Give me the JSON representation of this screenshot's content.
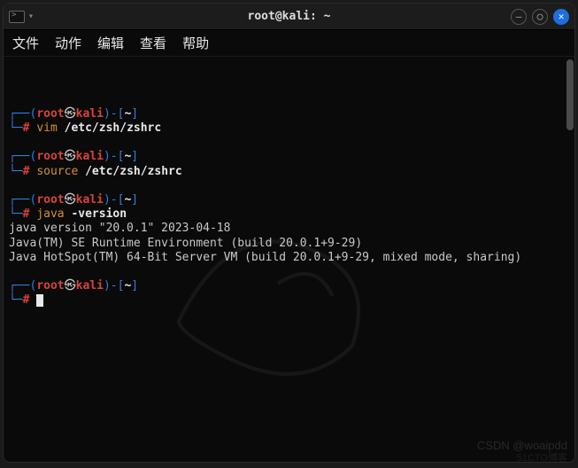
{
  "titlebar": {
    "title": "root@kali: ~"
  },
  "menubar": {
    "items": [
      "文件",
      "动作",
      "编辑",
      "查看",
      "帮助"
    ]
  },
  "prompt": {
    "user": "root",
    "at": "㉿",
    "host": "kali",
    "cwd": "~",
    "open_paren": "(",
    "close_paren": ")",
    "dash_open": "-[",
    "close_bracket": "]",
    "box_top_l": "┌──",
    "box_bot_l": "└─",
    "hash": "#"
  },
  "blocks": [
    {
      "cmd_pre": "vim ",
      "cmd_post": "/etc/zsh/zshrc",
      "output": []
    },
    {
      "cmd_pre": "source ",
      "cmd_post": "/etc/zsh/zshrc",
      "output": []
    },
    {
      "cmd_pre": "java ",
      "cmd_post": "-version",
      "output": [
        "java version \"20.0.1\" 2023-04-18",
        "Java(TM) SE Runtime Environment (build 20.0.1+9-29)",
        "Java HotSpot(TM) 64-Bit Server VM (build 20.0.1+9-29, mixed mode, sharing)"
      ]
    },
    {
      "cmd_pre": "",
      "cmd_post": "",
      "output": [],
      "cursor": true
    }
  ],
  "watermarks": {
    "csdn": "CSDN @woaipdd",
    "cto": "51CTO博客"
  }
}
